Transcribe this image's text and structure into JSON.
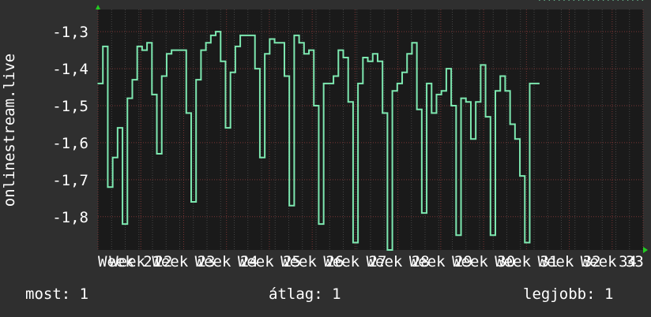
{
  "chart_data": {
    "type": "line",
    "ylabel": "onlinestream.live",
    "ylim": [
      -1.89,
      -1.24
    ],
    "yticks": [
      -1.8,
      -1.7,
      -1.6,
      -1.5,
      -1.4,
      -1.3
    ],
    "ytick_labels": [
      "-1,8",
      "-1,7",
      "-1,6",
      "-1,5",
      "-1,4",
      "-1,3"
    ],
    "xlim": [
      0,
      100
    ],
    "xticks": [
      0,
      7.86,
      15.72,
      23.58,
      31.44,
      39.3,
      47.16,
      55.02,
      62.88,
      70.74,
      78.6,
      86.46,
      94.32,
      100
    ],
    "xtick_labels": [
      "Week 21",
      "Week 22",
      "Week 23",
      "Week 24",
      "Week 25",
      "Week 26",
      "Week 27",
      "Week 28",
      "Week 29",
      "Week 30",
      "Week 31",
      "Week 32",
      "Week 33",
      "34"
    ],
    "grid": true,
    "line_color": "#7de8b0",
    "x": [
      0,
      0.9,
      1.8,
      2.7,
      3.6,
      4.5,
      5.4,
      6.3,
      7.2,
      8.1,
      9,
      9.9,
      10.8,
      11.7,
      12.6,
      13.5,
      14.4,
      15.3,
      16.2,
      17.1,
      18,
      18.9,
      19.8,
      20.7,
      21.6,
      22.5,
      23.4,
      24.3,
      25.2,
      26.1,
      27,
      27.9,
      28.8,
      29.7,
      30.6,
      31.5,
      32.4,
      33.3,
      34.2,
      35.1,
      36,
      36.9,
      37.8,
      38.7,
      39.6,
      40.5,
      41.4,
      42.3,
      43.2,
      44.1,
      45,
      45.9,
      46.8,
      47.7,
      48.6,
      49.5,
      50.4,
      51.3,
      52.2,
      53.1,
      54,
      54.9,
      55.8,
      56.7,
      57.6,
      58.5,
      59.4,
      60.3,
      61.2,
      62.1,
      63,
      63.9,
      64.8,
      65.7,
      66.6,
      67.5,
      68.4,
      69.3,
      70.2,
      71.1,
      72,
      72.9,
      73.8,
      74.7,
      75.6,
      76.5,
      77.4,
      78.3,
      79.2,
      80.1,
      81,
      81.9,
      82.8,
      83.7,
      84.6,
      85.5,
      86.4,
      87.3,
      88.2,
      89.1,
      90,
      90.9,
      91.8,
      92.7,
      93.6,
      94.5,
      95.4,
      96.3,
      97.2,
      98.1,
      99,
      99.9
    ],
    "y": [
      -1.44,
      -1.34,
      -1.72,
      -1.64,
      -1.56,
      -1.82,
      -1.48,
      -1.43,
      -1.34,
      -1.35,
      -1.33,
      -1.47,
      -1.63,
      -1.42,
      -1.36,
      -1.35,
      -1.35,
      -1.35,
      -1.52,
      -1.76,
      -1.43,
      -1.35,
      -1.33,
      -1.31,
      -1.3,
      -1.38,
      -1.56,
      -1.41,
      -1.34,
      -1.31,
      -1.31,
      -1.31,
      -1.4,
      -1.64,
      -1.36,
      -1.32,
      -1.33,
      -1.33,
      -1.42,
      -1.77,
      -1.31,
      -1.33,
      -1.36,
      -1.35,
      -1.5,
      -1.82,
      -1.44,
      -1.44,
      -1.42,
      -1.35,
      -1.37,
      -1.49,
      -1.87,
      -1.44,
      -1.37,
      -1.38,
      -1.36,
      -1.38,
      -1.52,
      -1.89,
      -1.46,
      -1.44,
      -1.41,
      -1.36,
      -1.33,
      -1.51,
      -1.79,
      -1.44,
      -1.52,
      -1.47,
      -1.46,
      -1.4,
      -1.5,
      -1.85,
      -1.48,
      -1.49,
      -1.59,
      -1.49,
      -1.39,
      -1.53,
      -1.85,
      -1.46,
      -1.42,
      -1.46,
      -1.55,
      -1.59,
      -1.69,
      -1.87,
      -1.44,
      -1.44
    ]
  },
  "stats": {
    "current": "most: 1",
    "average": "átlag: 1",
    "best": "legjobb: 1"
  }
}
